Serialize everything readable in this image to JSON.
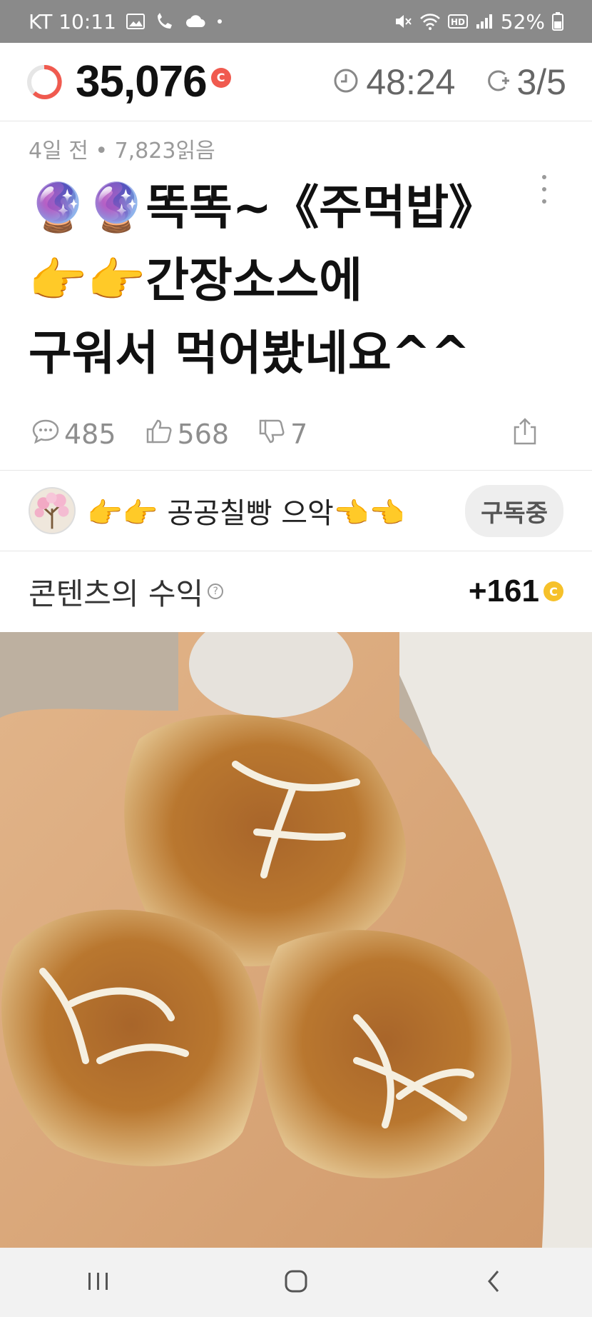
{
  "status_bar": {
    "carrier_time": "KT 10:11",
    "battery": "52%"
  },
  "header": {
    "points": "35,076",
    "points_coin_letter": "C",
    "timer": "48:24",
    "count": "3/5"
  },
  "article": {
    "meta": "4일 전 • 7,823읽음",
    "title_line1": "🔮🔮똑똑~《주먹밥》",
    "title_line2": "👉👉간장소스에",
    "title_line3": "구워서 먹어봤네요^^",
    "comments": "485",
    "likes": "568",
    "dislikes": "7"
  },
  "author": {
    "name": "👉👉 공공칠빵 으악👈👈",
    "subscribe_label": "구독중"
  },
  "revenue": {
    "label": "콘텐츠의 수익",
    "value": "+161",
    "coin_letter": "C"
  },
  "colors": {
    "accent_red": "#f05a4f",
    "coin_yellow": "#f6c12a",
    "status_bar_bg": "#8a8a8a"
  }
}
